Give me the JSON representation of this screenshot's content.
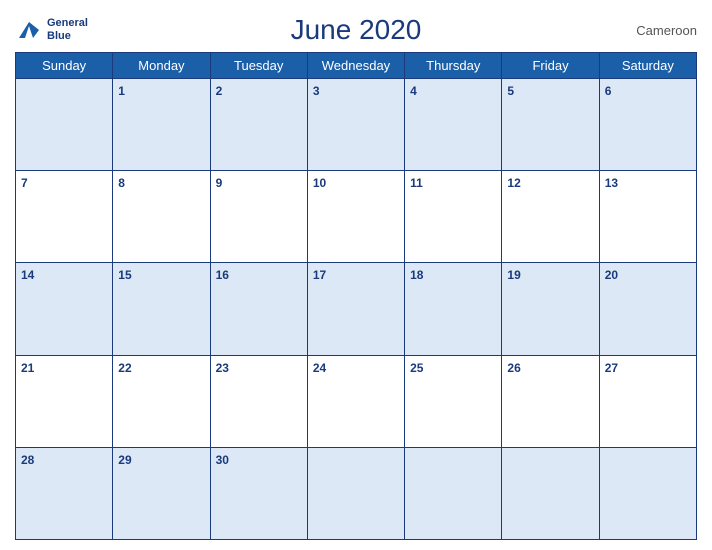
{
  "header": {
    "title": "June 2020",
    "country": "Cameroon",
    "logo": {
      "line1": "General",
      "line2": "Blue"
    }
  },
  "weekdays": [
    "Sunday",
    "Monday",
    "Tuesday",
    "Wednesday",
    "Thursday",
    "Friday",
    "Saturday"
  ],
  "weeks": [
    [
      null,
      1,
      2,
      3,
      4,
      5,
      6
    ],
    [
      7,
      8,
      9,
      10,
      11,
      12,
      13
    ],
    [
      14,
      15,
      16,
      17,
      18,
      19,
      20
    ],
    [
      21,
      22,
      23,
      24,
      25,
      26,
      27
    ],
    [
      28,
      29,
      30,
      null,
      null,
      null,
      null
    ]
  ]
}
